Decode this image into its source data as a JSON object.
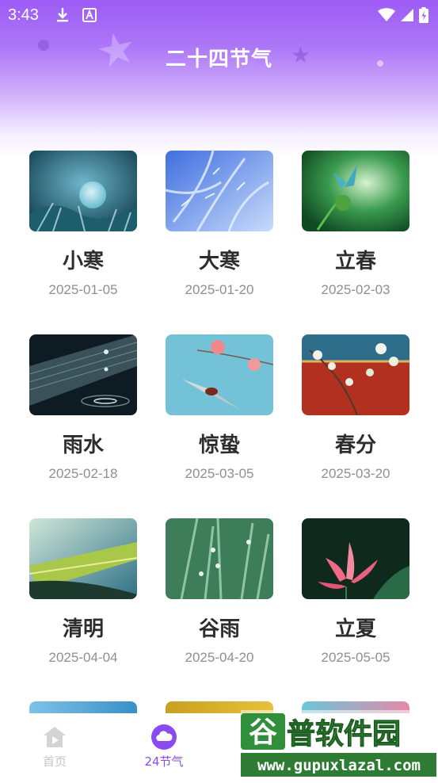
{
  "status_bar": {
    "time": "3:43"
  },
  "header": {
    "title": "二十四节气"
  },
  "terms": [
    {
      "name": "小寒",
      "date": "2025-01-05"
    },
    {
      "name": "大寒",
      "date": "2025-01-20"
    },
    {
      "name": "立春",
      "date": "2025-02-03"
    },
    {
      "name": "雨水",
      "date": "2025-02-18"
    },
    {
      "name": "惊蛰",
      "date": "2025-03-05"
    },
    {
      "name": "春分",
      "date": "2025-03-20"
    },
    {
      "name": "清明",
      "date": "2025-04-04"
    },
    {
      "name": "谷雨",
      "date": "2025-04-20"
    },
    {
      "name": "立夏",
      "date": "2025-05-05"
    }
  ],
  "bottom_nav": {
    "home_label": "首页",
    "solar_terms_label": "24节气",
    "active_color": "#8a4cf0",
    "inactive_color": "#c5c5c5"
  },
  "watermark": {
    "title": "谷普软件园",
    "url": "www.gupuxlazal.com"
  }
}
